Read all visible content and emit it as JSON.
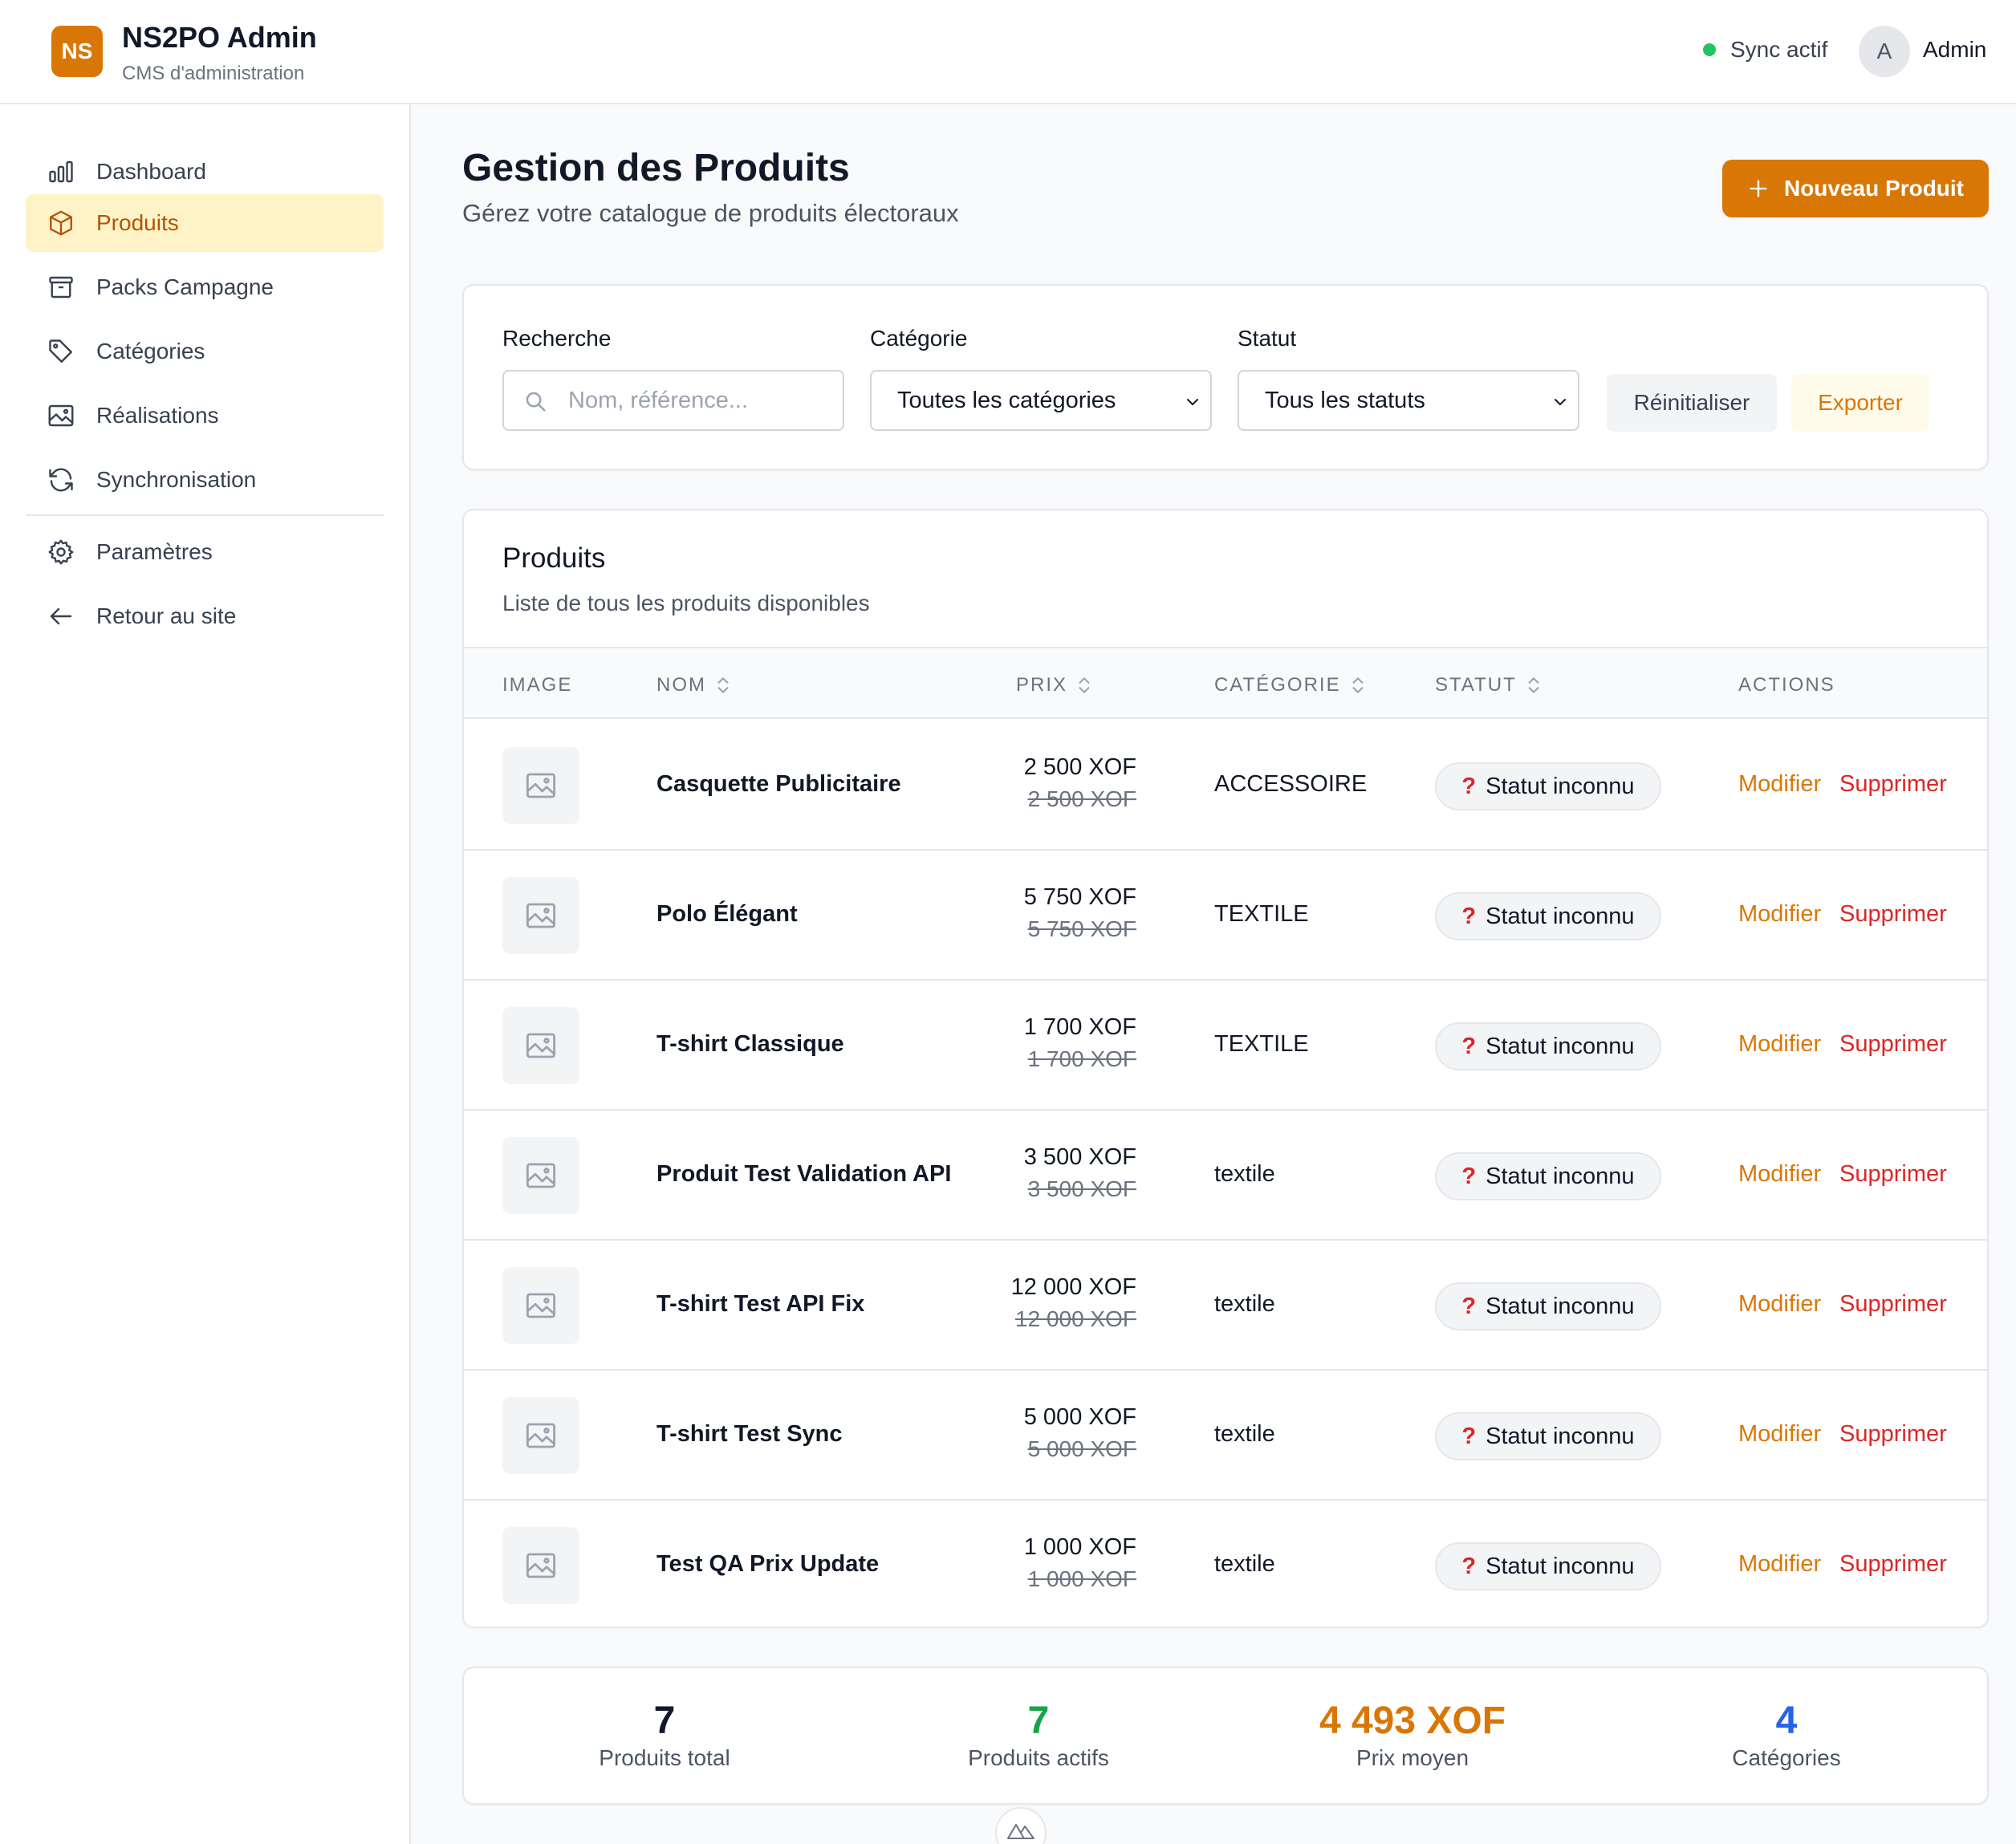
{
  "header": {
    "logo_text": "NS",
    "app_title": "NS2PO Admin",
    "app_subtitle": "CMS d'administration",
    "sync_label": "Sync actif",
    "avatar_initial": "A",
    "user_name": "Admin"
  },
  "sidebar": {
    "items": [
      {
        "label": "Dashboard",
        "icon": "bar-chart-icon"
      },
      {
        "label": "Produits",
        "icon": "cube-icon",
        "active": true
      },
      {
        "label": "Packs Campagne",
        "icon": "archive-box-icon"
      },
      {
        "label": "Catégories",
        "icon": "tag-icon"
      },
      {
        "label": "Réalisations",
        "icon": "image-icon"
      },
      {
        "label": "Synchronisation",
        "icon": "refresh-icon"
      },
      {
        "label": "Paramètres",
        "icon": "gear-icon"
      },
      {
        "label": "Retour au site",
        "icon": "arrow-left-icon"
      }
    ]
  },
  "page": {
    "title": "Gestion des Produits",
    "subtitle": "Gérez votre catalogue de produits électoraux",
    "new_button": "Nouveau Produit"
  },
  "filters": {
    "search_label": "Recherche",
    "search_placeholder": "Nom, référence...",
    "category_label": "Catégorie",
    "category_value": "Toutes les catégories",
    "status_label": "Statut",
    "status_value": "Tous les statuts",
    "reset_button": "Réinitialiser",
    "export_button": "Exporter"
  },
  "products": {
    "title": "Produits",
    "subtitle": "Liste de tous les produits disponibles",
    "columns": [
      "IMAGE",
      "NOM",
      "PRIX",
      "CATÉGORIE",
      "STATUT",
      "ACTIONS"
    ],
    "rows": [
      {
        "name": "Casquette Publicitaire",
        "price": "2 500 XOF",
        "old_price": "2 500 XOF",
        "category": "ACCESSOIRE",
        "status": "Statut inconnu",
        "status_icon": "?",
        "edit": "Modifier",
        "delete": "Supprimer"
      },
      {
        "name": "Polo Élégant",
        "price": "5 750 XOF",
        "old_price": "5 750 XOF",
        "category": "TEXTILE",
        "status": "Statut inconnu",
        "status_icon": "?",
        "edit": "Modifier",
        "delete": "Supprimer"
      },
      {
        "name": "T-shirt Classique",
        "price": "1 700 XOF",
        "old_price": "1 700 XOF",
        "category": "TEXTILE",
        "status": "Statut inconnu",
        "status_icon": "?",
        "edit": "Modifier",
        "delete": "Supprimer"
      },
      {
        "name": "Produit Test Validation API",
        "price": "3 500 XOF",
        "old_price": "3 500 XOF",
        "category": "textile",
        "status": "Statut inconnu",
        "status_icon": "?",
        "edit": "Modifier",
        "delete": "Supprimer"
      },
      {
        "name": "T-shirt Test API Fix",
        "price": "12 000 XOF",
        "old_price": "12 000 XOF",
        "category": "textile",
        "status": "Statut inconnu",
        "status_icon": "?",
        "edit": "Modifier",
        "delete": "Supprimer"
      },
      {
        "name": "T-shirt Test Sync",
        "price": "5 000 XOF",
        "old_price": "5 000 XOF",
        "category": "textile",
        "status": "Statut inconnu",
        "status_icon": "?",
        "edit": "Modifier",
        "delete": "Supprimer"
      },
      {
        "name": "Test QA Prix Update",
        "price": "1 000 XOF",
        "old_price": "1 000 XOF",
        "category": "textile",
        "status": "Statut inconnu",
        "status_icon": "?",
        "edit": "Modifier",
        "delete": "Supprimer"
      }
    ]
  },
  "stats": [
    {
      "value": "7",
      "label": "Produits total",
      "color": "#111827"
    },
    {
      "value": "7",
      "label": "Produits actifs",
      "color": "#16a34a"
    },
    {
      "value": "4 493 XOF",
      "label": "Prix moyen",
      "color": "#d97706"
    },
    {
      "value": "4",
      "label": "Catégories",
      "color": "#2563eb"
    }
  ],
  "colors": {
    "accent": "#d97706",
    "danger": "#dc2626",
    "success": "#22c55e",
    "active_bg": "#fef3c7"
  }
}
